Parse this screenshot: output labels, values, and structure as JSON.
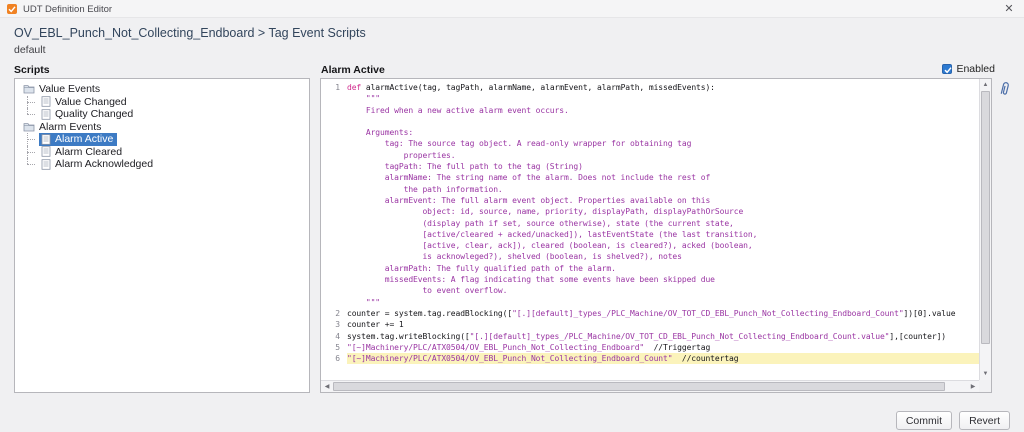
{
  "window": {
    "title": "UDT Definition Editor",
    "close_glyph": "✕"
  },
  "header": {
    "breadcrumb": "OV_EBL_Punch_Not_Collecting_Endboard > Tag Event Scripts",
    "subtitle": "default"
  },
  "scripts_panel": {
    "title": "Scripts",
    "items": [
      {
        "label": "Value Events",
        "kind": "folder",
        "level": 0,
        "selected": false
      },
      {
        "label": "Value Changed",
        "kind": "script",
        "level": 1,
        "selected": false
      },
      {
        "label": "Quality Changed",
        "kind": "script",
        "level": 1,
        "selected": false,
        "last": true
      },
      {
        "label": "Alarm Events",
        "kind": "folder",
        "level": 0,
        "selected": false
      },
      {
        "label": "Alarm Active",
        "kind": "script",
        "level": 1,
        "selected": true
      },
      {
        "label": "Alarm Cleared",
        "kind": "script",
        "level": 1,
        "selected": false
      },
      {
        "label": "Alarm Acknowledged",
        "kind": "script",
        "level": 1,
        "selected": false,
        "last": true
      }
    ]
  },
  "editor": {
    "title": "Alarm Active",
    "enabled_label": "Enabled",
    "enabled_checked": true,
    "lines": [
      {
        "num": "1",
        "segs": [
          [
            "kw",
            "def"
          ],
          [
            "plain",
            " "
          ],
          [
            "fn",
            "alarmActive"
          ],
          [
            "plain",
            "(tag, tagPath, alarmName, alarmEvent, alarmPath, missedEvents):"
          ]
        ]
      },
      {
        "num": "",
        "segs": [
          [
            "str",
            "    \"\"\""
          ]
        ]
      },
      {
        "num": "",
        "segs": [
          [
            "str",
            "    Fired when a new active alarm event occurs."
          ]
        ]
      },
      {
        "num": "",
        "segs": [
          [
            "str",
            ""
          ]
        ]
      },
      {
        "num": "",
        "segs": [
          [
            "str",
            "    Arguments:"
          ]
        ]
      },
      {
        "num": "",
        "segs": [
          [
            "str",
            "        tag: The source tag object. A read-only wrapper for obtaining tag"
          ]
        ]
      },
      {
        "num": "",
        "segs": [
          [
            "str",
            "            properties."
          ]
        ]
      },
      {
        "num": "",
        "segs": [
          [
            "str",
            "        tagPath: The full path to the tag (String)"
          ]
        ]
      },
      {
        "num": "",
        "segs": [
          [
            "str",
            "        alarmName: The string name of the alarm. Does not include the rest of"
          ]
        ]
      },
      {
        "num": "",
        "segs": [
          [
            "str",
            "            the path information."
          ]
        ]
      },
      {
        "num": "",
        "segs": [
          [
            "str",
            "        alarmEvent: The full alarm event object. Properties available on this"
          ]
        ]
      },
      {
        "num": "",
        "segs": [
          [
            "str",
            "                object: id, source, name, priority, displayPath, displayPathOrSource"
          ]
        ]
      },
      {
        "num": "",
        "segs": [
          [
            "str",
            "                (display path if set, source otherwise), state (the current state,"
          ]
        ]
      },
      {
        "num": "",
        "segs": [
          [
            "str",
            "                [active/cleared + acked/unacked]), lastEventState (the last transition,"
          ]
        ]
      },
      {
        "num": "",
        "segs": [
          [
            "str",
            "                [active, clear, ack]), cleared (boolean, is cleared?), acked (boolean,"
          ]
        ]
      },
      {
        "num": "",
        "segs": [
          [
            "str",
            "                is acknowleged?), shelved (boolean, is shelved?), notes"
          ]
        ]
      },
      {
        "num": "",
        "segs": [
          [
            "str",
            "        alarmPath: The fully qualified path of the alarm."
          ]
        ]
      },
      {
        "num": "",
        "segs": [
          [
            "str",
            "        missedEvents: A flag indicating that some events have been skipped due"
          ]
        ]
      },
      {
        "num": "",
        "segs": [
          [
            "str",
            "                to event overflow."
          ]
        ]
      },
      {
        "num": "",
        "segs": [
          [
            "str",
            "    \"\"\""
          ]
        ]
      },
      {
        "num": "2",
        "segs": [
          [
            "plain",
            "counter = system.tag.readBlocking(["
          ],
          [
            "str",
            "\"[.][default]_types_/PLC_Machine/OV_TOT_CD_EBL_Punch_Not_Collecting_Endboard_Count\""
          ],
          [
            "plain",
            "])[0].value"
          ]
        ]
      },
      {
        "num": "3",
        "segs": [
          [
            "plain",
            "counter += 1"
          ]
        ]
      },
      {
        "num": "4",
        "segs": [
          [
            "plain",
            "system.tag.writeBlocking(["
          ],
          [
            "str",
            "\"[.][default]_types_/PLC_Machine/OV_TOT_CD_EBL_Punch_Not_Collecting_Endboard_Count.value\""
          ],
          [
            "plain",
            "],[counter])"
          ]
        ]
      },
      {
        "num": "5",
        "segs": [
          [
            "str",
            "\"[~]Machinery/PLC/ATX0504/OV_EBL_Punch_Not_Collecting_Endboard\""
          ],
          [
            "plain",
            "  //Triggertag"
          ]
        ]
      },
      {
        "num": "6",
        "hl": true,
        "segs": [
          [
            "str",
            "\"[~]Machinery/PLC/ATX0504/OV_EBL_Punch_Not_Collecting_Endboard_Count\""
          ],
          [
            "plain",
            "  //countertag"
          ]
        ]
      }
    ]
  },
  "footer": {
    "commit": "Commit",
    "revert": "Revert"
  },
  "colors": {
    "selection_blue": "#3d7bc4",
    "line_highlight_yellow": "#fbf3bb",
    "keyword_pink": "#d02a8c",
    "string_purple": "#9a35a3",
    "checkbox_blue": "#2d7ad1",
    "logo_orange": "#f08223"
  }
}
